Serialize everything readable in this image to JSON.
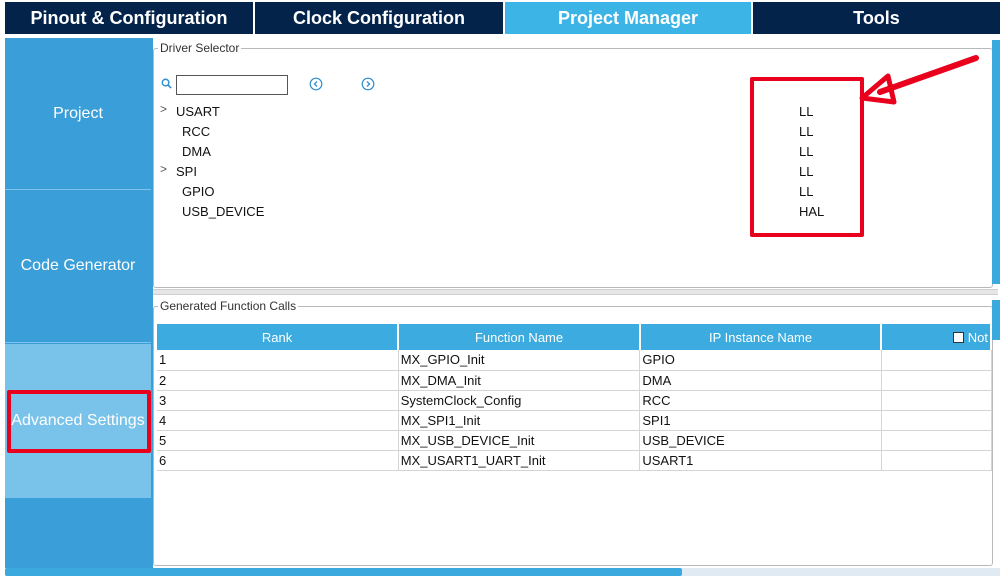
{
  "tabs": [
    {
      "label": "Pinout & Configuration"
    },
    {
      "label": "Clock Configuration"
    },
    {
      "label": "Project Manager"
    },
    {
      "label": "Tools"
    }
  ],
  "sidebar": {
    "items": [
      {
        "label": "Project"
      },
      {
        "label": "Code Generator"
      },
      {
        "label": "Advanced Settings"
      }
    ]
  },
  "driver_selector": {
    "legend": "Driver Selector",
    "search_value": "",
    "rows": [
      {
        "name": "USART",
        "mode": "LL",
        "expandable": true
      },
      {
        "name": "RCC",
        "mode": "LL",
        "expandable": false
      },
      {
        "name": "DMA",
        "mode": "LL",
        "expandable": false
      },
      {
        "name": "SPI",
        "mode": "LL",
        "expandable": true
      },
      {
        "name": "GPIO",
        "mode": "LL",
        "expandable": false
      },
      {
        "name": "USB_DEVICE",
        "mode": "HAL",
        "expandable": false
      }
    ]
  },
  "generated_calls": {
    "legend": "Generated Function Calls",
    "headers": {
      "rank": "Rank",
      "function": "Function Name",
      "ip": "IP Instance Name",
      "not": "Not"
    },
    "rows": [
      {
        "rank": "1",
        "function": "MX_GPIO_Init",
        "ip": "GPIO"
      },
      {
        "rank": "2",
        "function": "MX_DMA_Init",
        "ip": "DMA"
      },
      {
        "rank": "3",
        "function": "SystemClock_Config",
        "ip": "RCC"
      },
      {
        "rank": "4",
        "function": "MX_SPI1_Init",
        "ip": "SPI1"
      },
      {
        "rank": "5",
        "function": "MX_USB_DEVICE_Init",
        "ip": "USB_DEVICE"
      },
      {
        "rank": "6",
        "function": "MX_USART1_UART_Init",
        "ip": "USART1"
      }
    ]
  },
  "colors": {
    "dark_tab": "#03234b",
    "active_tab": "#3cb4e6",
    "sidebar": "#3a9ed8",
    "highlight": "#e8001c"
  },
  "icons": [
    "search-icon",
    "chevron-left-icon",
    "chevron-right-icon",
    "chevron-right-expand-icon",
    "arrow-annotation-icon"
  ]
}
